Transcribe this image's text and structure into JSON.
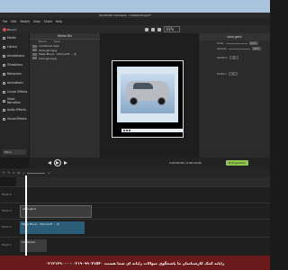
{
  "window": {
    "title": "TechSmith Camtasia - Untitled Project*"
  },
  "menu": [
    "File",
    "Edit",
    "Modify",
    "View",
    "Share",
    "Help"
  ],
  "toolbar": {
    "record_label": "Record",
    "zoom_value": "43%"
  },
  "sidebar": {
    "items": [
      {
        "label": "Media",
        "icon": "media-icon"
      },
      {
        "label": "Library",
        "icon": "library-icon"
      },
      {
        "label": "Annotations",
        "icon": "annotations-icon"
      },
      {
        "label": "Transitions",
        "icon": "transitions-icon"
      },
      {
        "label": "Behaviors",
        "icon": "behaviors-icon"
      },
      {
        "label": "Animations",
        "icon": "animations-icon"
      },
      {
        "label": "Cursor Effects",
        "icon": "cursor-icon"
      },
      {
        "label": "Voice Narration",
        "icon": "mic-icon"
      },
      {
        "label": "Audio Effects",
        "icon": "audio-icon"
      },
      {
        "label": "Visual Effects",
        "icon": "visual-icon"
      }
    ],
    "more_label": "More"
  },
  "media_bin": {
    "title": "Media Bin",
    "columns": [
      "Name",
      "Type"
    ],
    "rows": [
      {
        "name": "combined.mp4"
      },
      {
        "name": "slow-gerd.jpg"
      },
      {
        "name": "Mese Music - Microsoft ... (I)"
      },
      {
        "name": "slow-gerd.jpg"
      }
    ]
  },
  "properties": {
    "title": "slow-gerd",
    "rows": [
      {
        "label": "Scale",
        "value": "100%"
      },
      {
        "label": "Opacity",
        "value": "100%"
      },
      {
        "label": "Rotation",
        "value": "0"
      },
      {
        "label": "Position",
        "value": "0"
      }
    ]
  },
  "playback": {
    "timecode": "0:00:00;00 / 0:00:10;00",
    "properties_button": "Properties"
  },
  "timeline": {
    "tracks": [
      {
        "label": "Track 4",
        "clip": ""
      },
      {
        "label": "Track 3",
        "clip": "slow-gerd"
      },
      {
        "label": "Track 2",
        "clip": "Mese Music - Microsoft ... (I)"
      },
      {
        "label": "Track 1",
        "clip": "combined"
      }
    ]
  },
  "footer": {
    "text": "رایانه کمک کارشناسان ما پاسخگوی سوالات رایانه ای شما هستند ۰۲۱۹۰۹۹۰۷۱۵۴۰ - ۰۲۱۲۱۲۹۰۰۰"
  }
}
